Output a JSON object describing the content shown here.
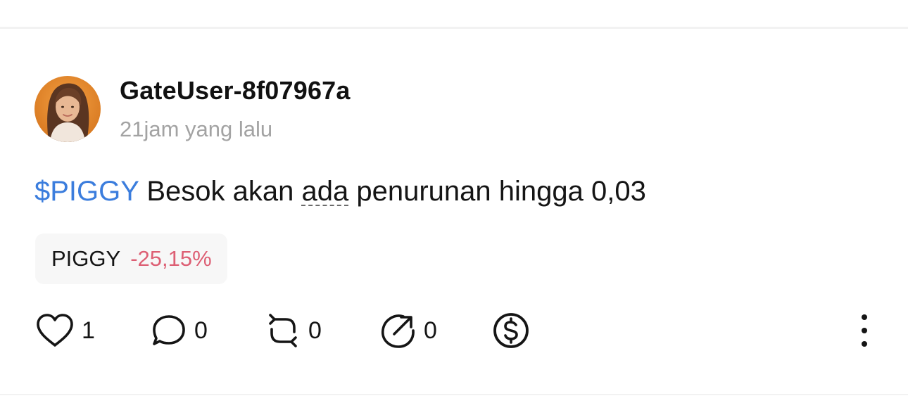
{
  "post": {
    "author": {
      "username": "GateUser-8f07967a",
      "avatar_icon": "user-avatar-photo"
    },
    "timestamp": "21jam yang lalu",
    "content": {
      "cashtag": "$PIGGY",
      "text_before": " Besok akan ",
      "underlined_word": "ada",
      "text_after": " penurunan hingga 0,03"
    },
    "ticker": {
      "symbol": "PIGGY",
      "change": "-25,15%",
      "change_color": "#dd5f74"
    },
    "actions": {
      "like": {
        "icon": "heart-icon",
        "count": "1"
      },
      "comment": {
        "icon": "comment-icon",
        "count": "0"
      },
      "repost": {
        "icon": "repost-icon",
        "count": "0"
      },
      "share": {
        "icon": "share-icon",
        "count": "0"
      },
      "tip": {
        "icon": "dollar-icon"
      },
      "more": {
        "icon": "more-vertical-icon"
      }
    }
  },
  "colors": {
    "cashtag": "#3b7ddd",
    "text": "#151515",
    "muted": "#a3a3a3"
  }
}
